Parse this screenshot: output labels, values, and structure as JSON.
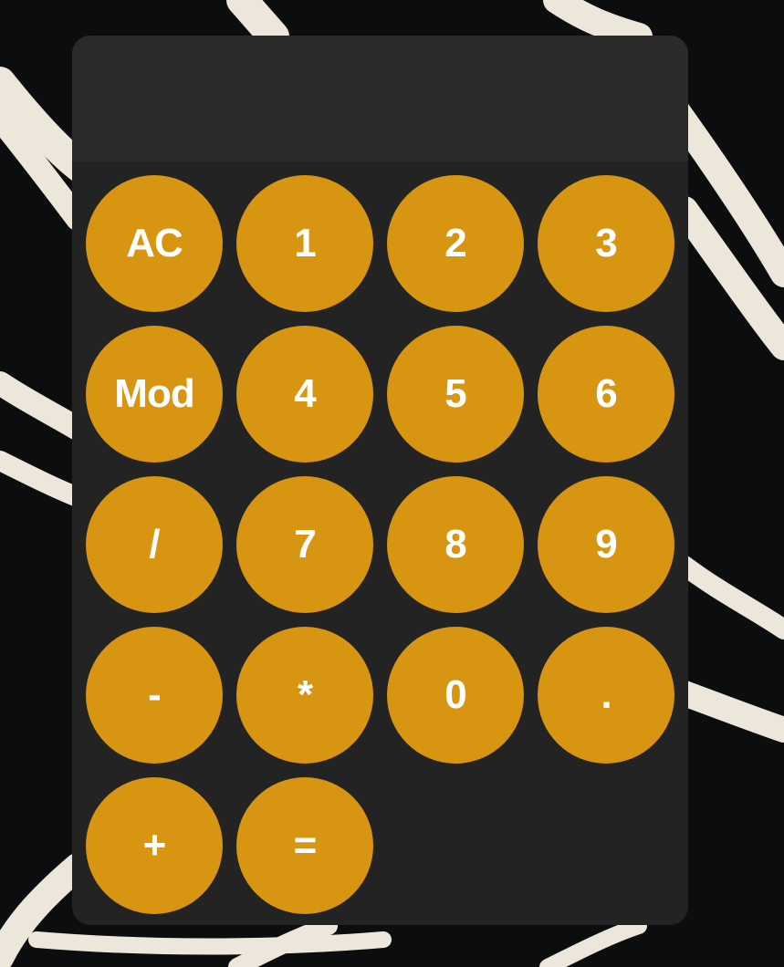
{
  "display": {
    "value": ""
  },
  "keys": [
    {
      "name": "key-clear",
      "label": "AC"
    },
    {
      "name": "key-1",
      "label": "1"
    },
    {
      "name": "key-2",
      "label": "2"
    },
    {
      "name": "key-3",
      "label": "3"
    },
    {
      "name": "key-mod",
      "label": "Mod"
    },
    {
      "name": "key-4",
      "label": "4"
    },
    {
      "name": "key-5",
      "label": "5"
    },
    {
      "name": "key-6",
      "label": "6"
    },
    {
      "name": "key-divide",
      "label": "/"
    },
    {
      "name": "key-7",
      "label": "7"
    },
    {
      "name": "key-8",
      "label": "8"
    },
    {
      "name": "key-9",
      "label": "9"
    },
    {
      "name": "key-subtract",
      "label": "-"
    },
    {
      "name": "key-multiply",
      "label": "*"
    },
    {
      "name": "key-0",
      "label": "0"
    },
    {
      "name": "key-decimal",
      "label": "."
    },
    {
      "name": "key-add",
      "label": "+"
    },
    {
      "name": "key-equals",
      "label": "="
    }
  ],
  "colors": {
    "key_background": "#d89512",
    "key_text": "#ffffff",
    "calculator_body": "#232323",
    "display_background": "#2b2b2b",
    "wallpaper_dark": "#0b0d0f",
    "wallpaper_lines": "#ede6da"
  }
}
